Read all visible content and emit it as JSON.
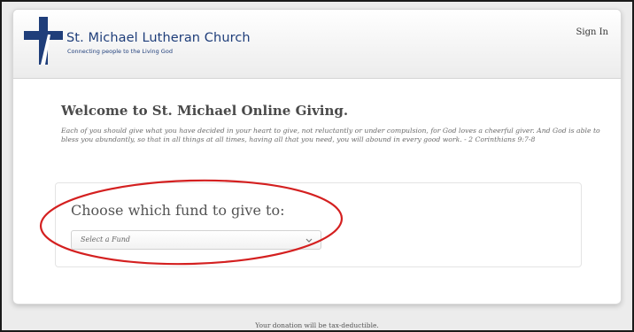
{
  "header": {
    "church_name": "St. Michael Lutheran Church",
    "tagline": "Connecting people to the Living God",
    "logo_icon": "cross-icon",
    "signin_label": "Sign In"
  },
  "main": {
    "title": "Welcome to St. Michael Online Giving.",
    "scripture": "Each of you should give what you have decided in your heart to give, not reluctantly or under compulsion, for God loves a cheerful giver.  And God is able to bless you abundantly, so that in all things at all times, having all that you need, you will abound in every good work.  - 2 Corinthians 9:7-8",
    "fund_prompt": "Choose which fund to give to:",
    "fund_select": {
      "selected": "Select a Fund",
      "icon": "chevron-down-icon"
    }
  },
  "footer": {
    "note": "Your donation will be tax-deductible."
  },
  "colors": {
    "brand_blue": "#1f3e7a",
    "annotation_red": "#d42020"
  }
}
